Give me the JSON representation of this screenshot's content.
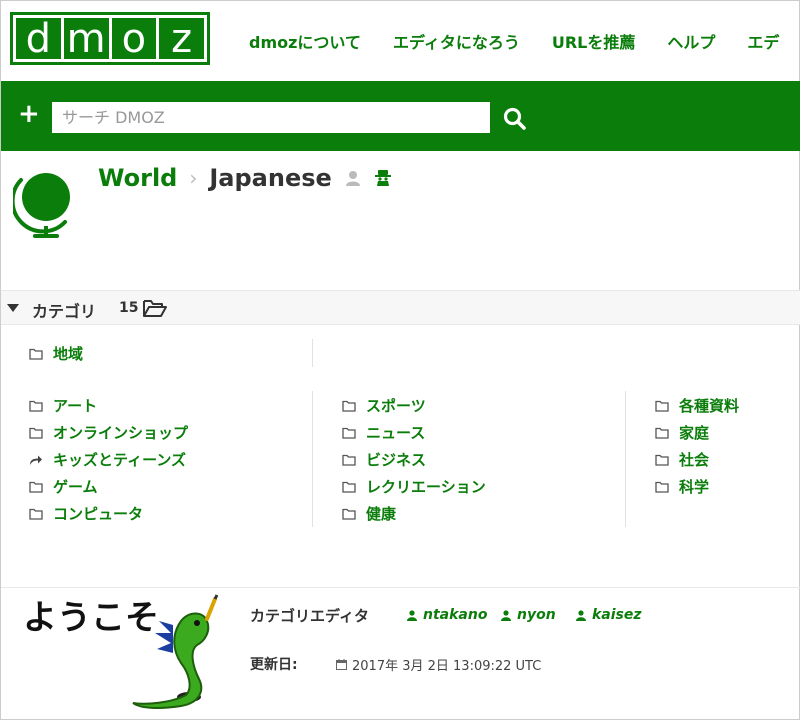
{
  "header": {
    "logo_letters": [
      "d",
      "m",
      "o",
      "z"
    ],
    "nav": [
      "dmozについて",
      "エディタになろう",
      "URLを推薦",
      "ヘルプ",
      "エデ"
    ]
  },
  "search": {
    "placeholder": "サーチ DMOZ",
    "value": ""
  },
  "breadcrumb": {
    "parent": "World",
    "current": "Japanese"
  },
  "categories": {
    "title": "カテゴリ",
    "count": "15",
    "featured": [
      "地域"
    ],
    "col1": [
      "アート",
      "オンラインショップ",
      "キッズとティーンズ",
      "ゲーム",
      "コンピュータ"
    ],
    "col2": [
      "スポーツ",
      "ニュース",
      "ビジネス",
      "レクリエーション",
      "健康"
    ],
    "col3": [
      "各種資料",
      "家庭",
      "社会",
      "科学"
    ]
  },
  "footer": {
    "mascot_text": "ようこそ",
    "editors_label": "カテゴリエディタ",
    "editors": [
      "ntakano",
      "nyon",
      "kaisez"
    ],
    "updated_label": "更新日:",
    "updated_value": "2017年 3月 2日 13:09:22 UTC"
  },
  "colors": {
    "brand": "#0b7d0b",
    "text": "#333333",
    "band": "#f7f7f7"
  },
  "icons": {
    "search": "search-icon",
    "plus": "plus-icon",
    "globe": "globe-icon",
    "folder": "folder-icon",
    "link": "share-arrow-icon",
    "user": "user-icon",
    "calendar": "calendar-icon"
  }
}
